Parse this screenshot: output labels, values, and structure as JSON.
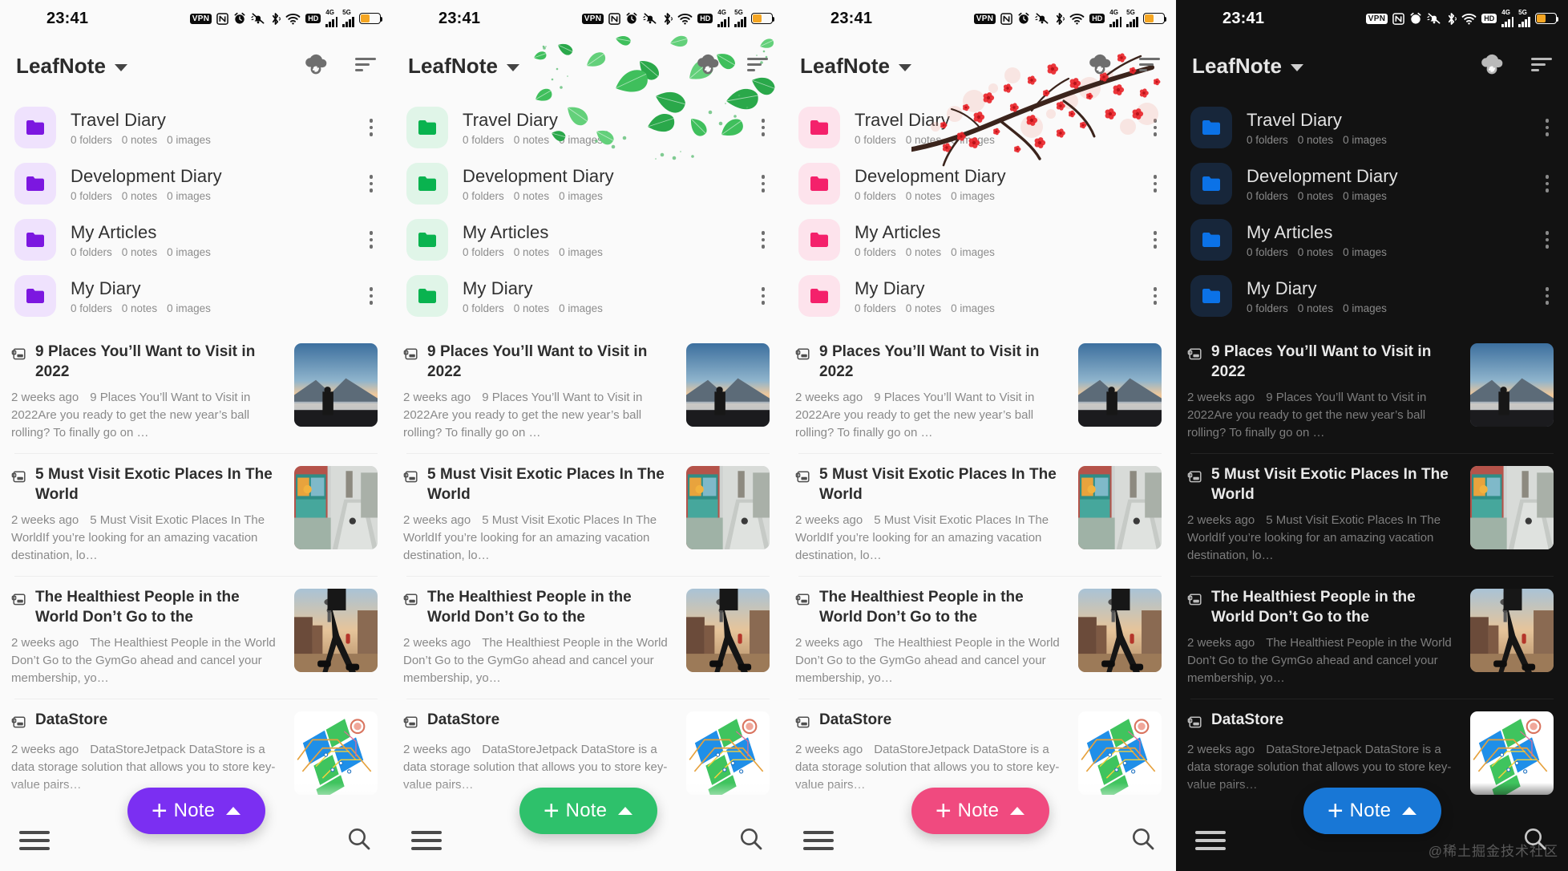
{
  "status_bar": {
    "time": "23:41",
    "icons": [
      "vpn-badge",
      "nfc-icon",
      "alarm-icon",
      "mute-bell-icon",
      "bluetooth-icon",
      "wifi-icon",
      "hd-badge",
      "signal-4g-icon",
      "signal-5g-icon",
      "battery-icon"
    ],
    "vpn_label": "VPN",
    "nfc_label": "N",
    "hd_label": "HD",
    "net_4g_label": "4G",
    "net_5g_label": "5G"
  },
  "app_bar": {
    "title": "LeafNote",
    "dropdown_icon": "chevron-down-icon",
    "cloud_sync_icon": "cloud-sync-icon",
    "sort_icon": "sort-icon"
  },
  "folders": [
    {
      "name": "Travel Diary",
      "folders": "0 folders",
      "notes": "0 notes",
      "images": "0 images"
    },
    {
      "name": "Development Diary",
      "folders": "0 folders",
      "notes": "0 notes",
      "images": "0 images"
    },
    {
      "name": "My Articles",
      "folders": "0 folders",
      "notes": "0 notes",
      "images": "0 images"
    },
    {
      "name": "My Diary",
      "folders": "0 folders",
      "notes": "0 notes",
      "images": "0 images"
    }
  ],
  "notes": [
    {
      "title": "9 Places You’ll Want to Visit in 2022",
      "ago": "2 weeks ago",
      "snippet": "9 Places You’ll Want to Visit in 2022Are you ready to get the new year’s ball rolling? To finally go on …",
      "thumb": "mountain-sunrise-photo"
    },
    {
      "title": "5 Must Visit Exotic Places In The World",
      "ago": "2 weeks ago",
      "snippet": "5 Must Visit Exotic Places In The WorldIf you’re looking for an amazing vacation destination, lo…",
      "thumb": "street-market-photo"
    },
    {
      "title": "The Healthiest People in the World Don’t Go to the",
      "ago": "2 weeks ago",
      "snippet": "The Healthiest People in the World Don’t Go to the GymGo ahead and cancel your membership, yo…",
      "thumb": "city-walking-photo"
    },
    {
      "title": "DataStore",
      "ago": "2 weeks ago",
      "snippet": "DataStoreJetpack DataStore is a data storage solution that allows you to store key-value pairs…",
      "thumb": "circuit-map-illustration"
    }
  ],
  "fab": {
    "label": "Note",
    "plus_icon": "plus-icon",
    "expand_icon": "chevron-up-icon"
  },
  "bottom_bar": {
    "menu_icon": "hamburger-menu-icon",
    "search_icon": "search-icon"
  },
  "watermark": "@稀土掘金技术社区",
  "themes": [
    {
      "id": "purple",
      "mode": "light",
      "accent": "#7c17e0",
      "chip_bg": "#efe2fd",
      "fab_bg": "#7b2ff2",
      "decoration": "none"
    },
    {
      "id": "green",
      "mode": "light",
      "accent": "#09b34f",
      "chip_bg": "#e0f5e8",
      "fab_bg": "#2ec16b",
      "decoration": "green-leaves"
    },
    {
      "id": "pink",
      "mode": "light",
      "accent": "#f4216b",
      "chip_bg": "#fde3ec",
      "fab_bg": "#f04a7f",
      "decoration": "plum-blossom"
    },
    {
      "id": "blue",
      "mode": "dark",
      "accent": "#0b72e7",
      "chip_bg": "#17263a",
      "fab_bg": "#1877d6",
      "decoration": "none"
    }
  ]
}
